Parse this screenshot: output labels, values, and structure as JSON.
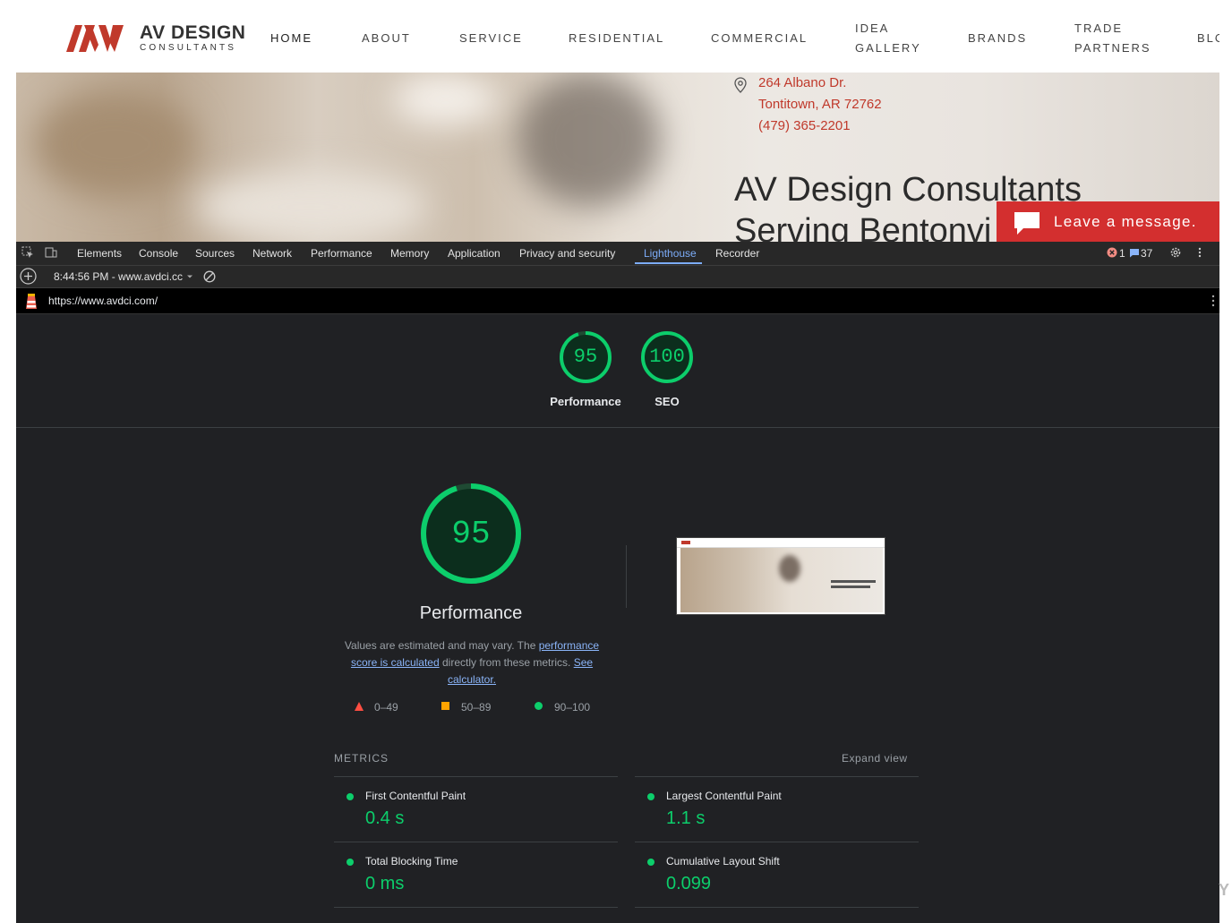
{
  "site": {
    "logo_title": "AV DESIGN",
    "logo_sub": "CONSULTANTS",
    "nav": [
      "HOME",
      "ABOUT",
      "SERVICE",
      "RESIDENTIAL",
      "COMMERCIAL",
      "IDEA",
      "GALLERY",
      "BRANDS",
      "TRADE",
      "PARTNERS",
      "BLO"
    ],
    "address_line1": "264 Albano Dr.",
    "address_line2": "Tontitown, AR 72762",
    "phone": "(479) 365-2201",
    "hero_title": "AV Design Consultants",
    "hero_subtitle": "Serving Bentonvi",
    "chat_label": "Leave a message.",
    "colors": {
      "brand_red": "#d32f2f"
    }
  },
  "devtools": {
    "tabs": [
      "Elements",
      "Console",
      "Sources",
      "Network",
      "Performance",
      "Memory",
      "Application",
      "Privacy and security",
      "Lighthouse",
      "Recorder"
    ],
    "active_tab": "Lighthouse",
    "error_count": "1",
    "message_count": "37",
    "report_time": "8:44:56 PM - www.avdci.cc",
    "url": "https://www.avdci.com/"
  },
  "lighthouse": {
    "summary": [
      {
        "score": "95",
        "label": "Performance"
      },
      {
        "score": "100",
        "label": "SEO"
      }
    ],
    "performance_score": "95",
    "performance_score_value": 95,
    "performance_title": "Performance",
    "desc_text1": "Values are estimated and may vary. The ",
    "desc_link1": "performance score is calculated",
    "desc_text2": " directly from these metrics. ",
    "desc_link2": "See calculator.",
    "legend": [
      {
        "range": "0–49",
        "shape": "triangle",
        "color": "#ff4e42"
      },
      {
        "range": "50–89",
        "shape": "square",
        "color": "#ffa400"
      },
      {
        "range": "90–100",
        "shape": "circle",
        "color": "#0cce6b"
      }
    ],
    "metrics_header": "METRICS",
    "expand_view": "Expand view",
    "metrics": [
      {
        "label": "First Contentful Paint",
        "value": "0.4 s"
      },
      {
        "label": "Largest Contentful Paint",
        "value": "1.1 s"
      },
      {
        "label": "Total Blocking Time",
        "value": "0 ms"
      },
      {
        "label": "Cumulative Layout Shift",
        "value": "0.099"
      }
    ],
    "colors": {
      "pass": "#0cce6b"
    }
  },
  "watermark": "Y"
}
